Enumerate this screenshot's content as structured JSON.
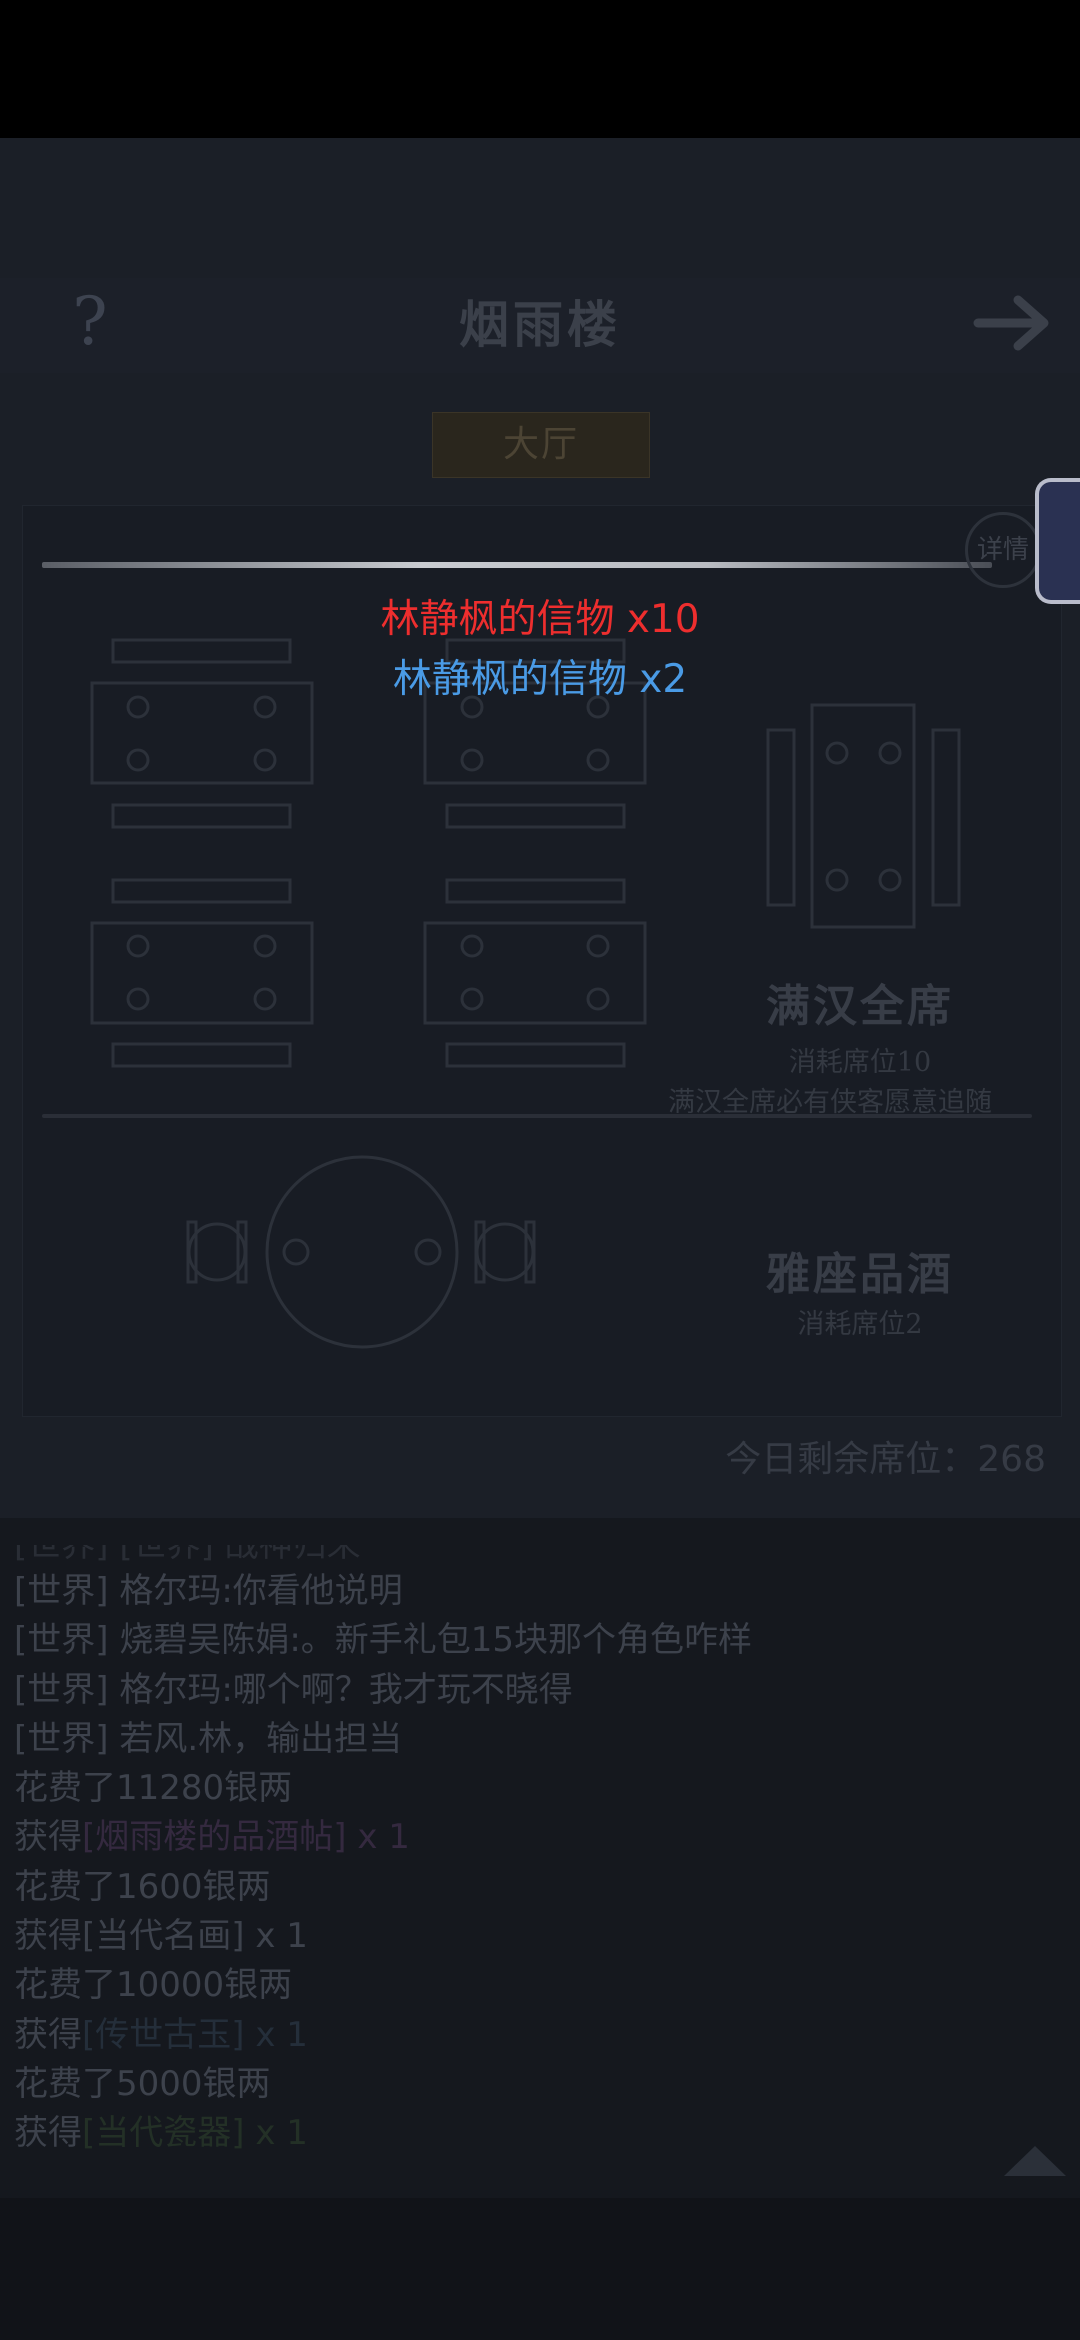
{
  "header": {
    "help_icon": "?",
    "title": "烟雨楼",
    "back_icon": "arrow-right-icon"
  },
  "tabs": {
    "active": "大厅"
  },
  "detail_label": "详情",
  "rewards": [
    {
      "text": "林静枫的信物 x10",
      "color": "#ee2e2e"
    },
    {
      "text": "林静枫的信物 x2",
      "color": "#4a9be6"
    }
  ],
  "options": [
    {
      "title": "满汉全席",
      "cost": "消耗席位10",
      "desc": "满汉全席必有侠客愿意追随"
    },
    {
      "title": "雅座品酒",
      "cost": "消耗席位2"
    }
  ],
  "remaining_seats": "今日剩余席位：268",
  "log": {
    "partial_line": "[世界] [世界] 战神归来",
    "lines": [
      {
        "prefix": "[世界] ",
        "text": "格尔玛:你看他说明"
      },
      {
        "prefix": "[世界] ",
        "text": "烧碧吴陈娟:。新手礼包15块那个角色咋样"
      },
      {
        "prefix": "[世界] ",
        "text": "格尔玛:哪个啊？我才玩不晓得"
      },
      {
        "prefix": "[世界] ",
        "text": "若风.林，输出担当"
      },
      {
        "text": "花费了11280银两"
      },
      {
        "text": "获得",
        "item": "[烟雨楼的品酒帖]",
        "suffix": " x 1",
        "item_color": "purple"
      },
      {
        "text": "花费了1600银两"
      },
      {
        "text": "获得",
        "item": "[当代名画]",
        "suffix": " x 1",
        "item_color": "plain"
      },
      {
        "text": "花费了10000银两"
      },
      {
        "text": "获得",
        "item": "[传世古玉]",
        "suffix": " x 1",
        "item_color": "blue"
      },
      {
        "text": "花费了5000银两"
      },
      {
        "text": "获得",
        "item": "[当代瓷器]",
        "suffix": " x 1",
        "item_color": "green"
      }
    ]
  }
}
